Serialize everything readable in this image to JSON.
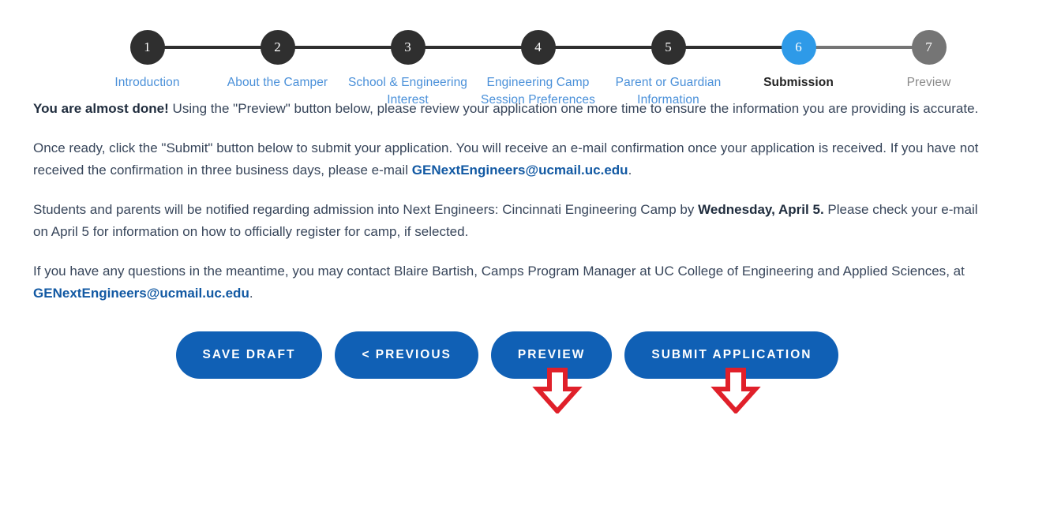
{
  "stepper": {
    "steps": [
      {
        "number": "1",
        "label": "Introduction",
        "state": "complete"
      },
      {
        "number": "2",
        "label": "About the Camper",
        "state": "complete"
      },
      {
        "number": "3",
        "label": "School & Engineering Interest",
        "state": "complete"
      },
      {
        "number": "4",
        "label": "Engineering Camp Session Preferences",
        "state": "complete"
      },
      {
        "number": "5",
        "label": "Parent or Guardian Information",
        "state": "complete"
      },
      {
        "number": "6",
        "label": "Submission",
        "state": "active"
      },
      {
        "number": "7",
        "label": "Preview",
        "state": "disabled"
      }
    ],
    "colors": {
      "complete": "#2f2f2f",
      "active": "#2e9ae8",
      "disabled": "#757575",
      "label": "#4a90d9"
    }
  },
  "content": {
    "paragraph1": {
      "lead": "You are almost done!",
      "rest": " Using the \"Preview\" button below, please review your application one more time to ensure the information you are providing is accurate."
    },
    "paragraph2": {
      "part1": "Once ready, click the \"Submit\" button below to submit your application. You will receive an e-mail confirmation once your application is received. If you have not received the confirmation in three business days, please e-mail ",
      "link": "GENextEngineers@ucmail.uc.edu",
      "part2": "."
    },
    "paragraph3": {
      "part1": "Students and parents will be notified regarding admission into Next Engineers: Cincinnati Engineering Camp by ",
      "bold": "Wednesday, April 5.",
      "part2": " Please check your e-mail on April 5 for information on how to officially register for camp, if selected."
    },
    "paragraph4": {
      "part1": "If you have any questions in the meantime, you may contact Blaire Bartish, Camps Program Manager at UC College of Engineering and Applied Sciences, at ",
      "link": "GENextEngineers@ucmail.uc.edu",
      "part2": "."
    }
  },
  "buttons": {
    "save_draft": "SAVE DRAFT",
    "previous": "< PREVIOUS",
    "preview": "PREVIEW",
    "submit": "SUBMIT APPLICATION",
    "color": "#1060b5"
  },
  "annotations": {
    "arrow_color": "#e0202a",
    "arrow_1_target": "PREVIEW",
    "arrow_2_target": "SUBMIT APPLICATION"
  }
}
